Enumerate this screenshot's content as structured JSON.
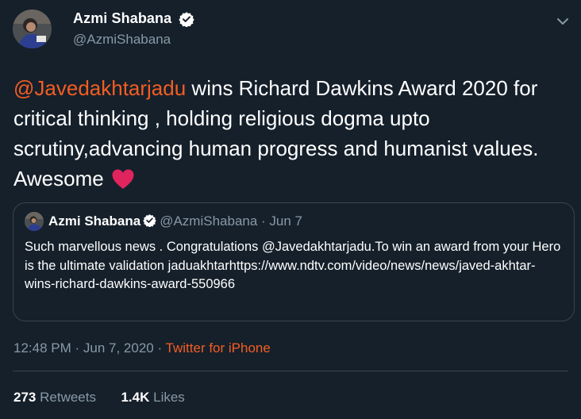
{
  "author": {
    "display_name": "Azmi Shabana",
    "handle": "@AzmiShabana"
  },
  "tweet": {
    "mention": "@Javedakhtarjadu",
    "text": " wins Richard Dawkins Award 2020 for critical thinking , holding religious dogma upto scrutiny,advancing human progress and humanist values. Awesome ",
    "emoji": "red-heart"
  },
  "quoted_tweet": {
    "display_name": "Azmi Shabana",
    "handle": "@AzmiShabana",
    "separator": " · ",
    "date": "Jun 7",
    "text": "Such marvellous news . Congratulations @Javedakhtarjadu.To win an award from your Hero is the ultimate validation jaduakhtarhttps://www.ndtv.com/video/news/news/javed-akhtar-wins-richard-dawkins-award-550966"
  },
  "meta": {
    "time": "12:48 PM",
    "separator1": " · ",
    "date": "Jun 7, 2020",
    "separator2": " · ",
    "source": "Twitter for iPhone"
  },
  "stats": {
    "retweets_count": "273",
    "retweets_label": "Retweets",
    "likes_count": "1.4K",
    "likes_label": "Likes"
  },
  "colors": {
    "background": "#15202b",
    "accent": "#f45d22",
    "secondary_text": "#8899a6",
    "border": "#38444d",
    "verified": "#ffffff",
    "heart": "#e0245e"
  },
  "icons": [
    "avatar",
    "verified-icon",
    "caret-down-icon",
    "heart-icon"
  ]
}
